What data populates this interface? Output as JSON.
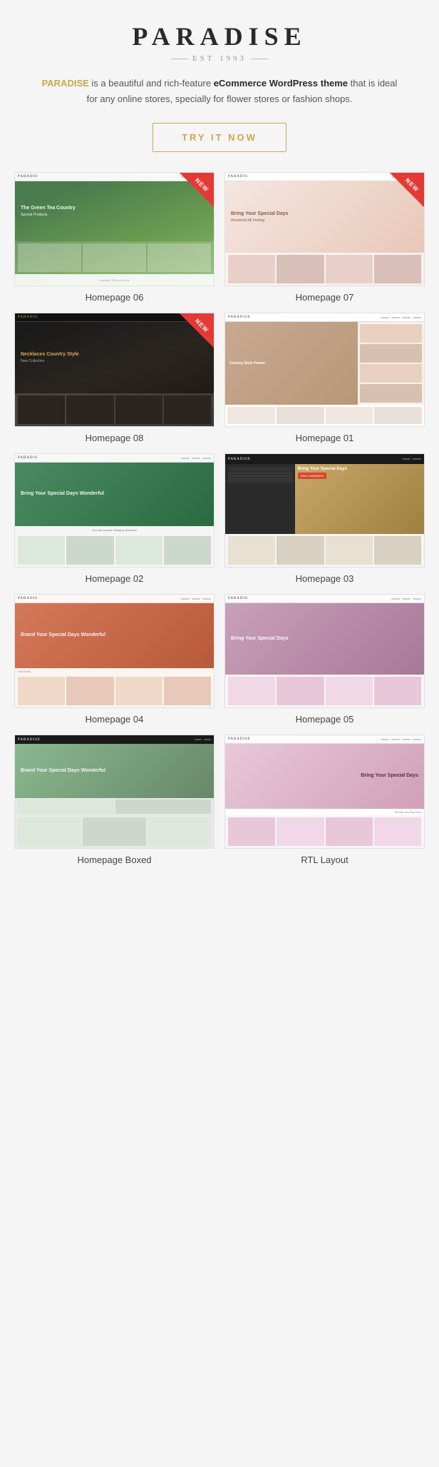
{
  "header": {
    "title": "PARADISE",
    "est": "EST 1993"
  },
  "description": {
    "brand": "PARADISE",
    "text_before": " is a beautiful and rich-feature ",
    "bold": "eCommerce WordPress theme",
    "text_after": " that is ideal for any online stores, specially for flower stores or fashion shops."
  },
  "cta": {
    "label": "TRY IT NOW"
  },
  "homepages": [
    {
      "id": "hp06",
      "label": "Homepage 06",
      "new": true
    },
    {
      "id": "hp07",
      "label": "Homepage 07",
      "new": true
    },
    {
      "id": "hp08",
      "label": "Homepage 08",
      "new": true
    },
    {
      "id": "hp01",
      "label": "Homepage 01",
      "new": false
    },
    {
      "id": "hp02",
      "label": "Homepage 02",
      "new": false
    },
    {
      "id": "hp03",
      "label": "Homepage 03",
      "new": false
    },
    {
      "id": "hp04",
      "label": "Homepage 04",
      "new": false
    },
    {
      "id": "hp05",
      "label": "Homepage 05",
      "new": false
    },
    {
      "id": "hp-boxed",
      "label": "Homepage Boxed",
      "new": false
    },
    {
      "id": "hp-rtl",
      "label": "RTL Layout",
      "new": false
    }
  ],
  "colors": {
    "gold": "#c9a84c",
    "red": "#e53935",
    "dark": "#2a2a2a"
  }
}
